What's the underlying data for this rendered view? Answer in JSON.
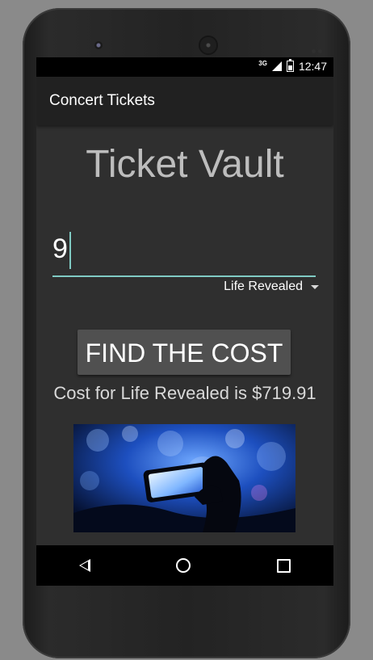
{
  "status": {
    "network": "3G",
    "time": "12:47"
  },
  "appbar": {
    "title": "Concert Tickets"
  },
  "main": {
    "heading": "Ticket Vault",
    "quantity_value": "9",
    "concert_selected": "Life Revealed",
    "button_label": "FIND THE COST",
    "result_text": "Cost for Life Revealed is $719.91",
    "image_description": "concert-crowd-phone-photo"
  },
  "colors": {
    "accent": "#80cbc4",
    "background": "#2f2f2f",
    "appbar": "#212121",
    "button": "#505050"
  },
  "icons": {
    "signal": "cell-signal-icon",
    "battery": "battery-icon",
    "back": "back-icon",
    "home": "home-icon",
    "recents": "recents-icon",
    "dropdown": "chevron-down-icon"
  }
}
